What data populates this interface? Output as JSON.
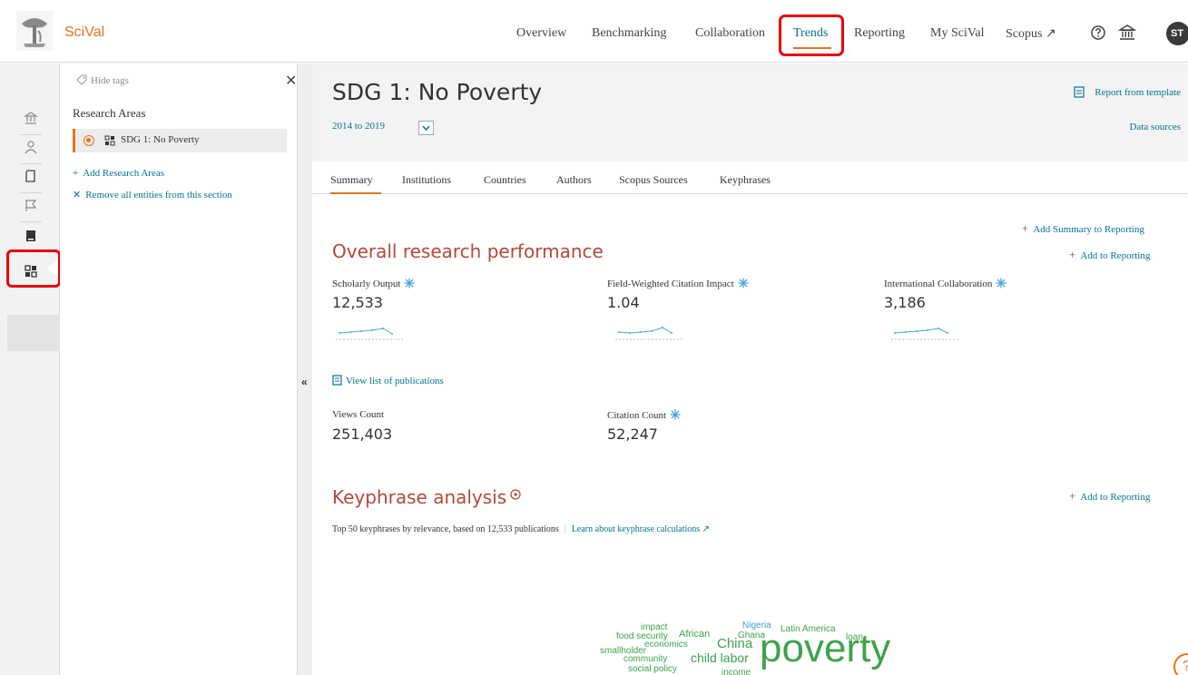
{
  "header": {
    "brand": "SciVal",
    "nav": [
      {
        "label": "Overview"
      },
      {
        "label": "Benchmarking"
      },
      {
        "label": "Collaboration"
      },
      {
        "label": "Trends"
      },
      {
        "label": "Reporting"
      },
      {
        "label": "My SciVal"
      },
      {
        "label": "Scopus ↗"
      }
    ],
    "active_nav": "Trends",
    "avatar_initials": "ST",
    "help_icon": "question-circle-icon",
    "institution_icon": "institution-icon"
  },
  "sidebar_rail": {
    "icons": [
      "institution-icon",
      "person-icon",
      "publication-icon",
      "flag-icon",
      "journal-icon",
      "research-area-icon"
    ],
    "active": "research-area-icon"
  },
  "entity_panel": {
    "hide_tags": "Hide tags",
    "section_title": "Research Areas",
    "selected_entity": "SDG 1: No Poverty",
    "add_link": "Add Research Areas",
    "remove_link": "Remove all entities from this section"
  },
  "main": {
    "title": "SDG 1: No Poverty",
    "date_range": "2014 to 2019",
    "report_link": "Report from template",
    "data_sources": "Data sources",
    "tabs": [
      {
        "label": "Summary"
      },
      {
        "label": "Institutions"
      },
      {
        "label": "Countries"
      },
      {
        "label": "Authors"
      },
      {
        "label": "Scopus Sources"
      },
      {
        "label": "Keyphrases"
      }
    ],
    "active_tab": "Summary",
    "add_summary": "Add Summary to Reporting",
    "overall": {
      "title": "Overall research performance",
      "add_link": "Add to Reporting",
      "metrics": [
        {
          "label": "Scholarly Output",
          "value": "12,533"
        },
        {
          "label": "Field-Weighted Citation Impact",
          "value": "1.04"
        },
        {
          "label": "International Collaboration",
          "value": "3,186"
        }
      ],
      "view_publications": "View list of publications",
      "metrics2": [
        {
          "label": "Views Count",
          "value": "251,403"
        },
        {
          "label": "Citation Count",
          "value": "52,247"
        }
      ]
    },
    "keyphrases": {
      "title": "Keyphrase analysis",
      "add_link": "Add to Reporting",
      "description": "Top 50 keyphrases by relevance, based on 12,533 publications",
      "learn_link": "Learn about keyphrase calculations ↗",
      "words": [
        "impact",
        "food security",
        "African",
        "Nigeria",
        "Latin America",
        "Ghana",
        "loan",
        "economics",
        "China",
        "smallholder",
        "community",
        "child labor",
        "poverty",
        "social policy",
        "income"
      ],
      "word_color": "#3ea34a"
    }
  },
  "colors": {
    "accent": "#e9711c",
    "link": "#007398",
    "section_title": "#b7483a",
    "highlight": "#e8000b"
  }
}
